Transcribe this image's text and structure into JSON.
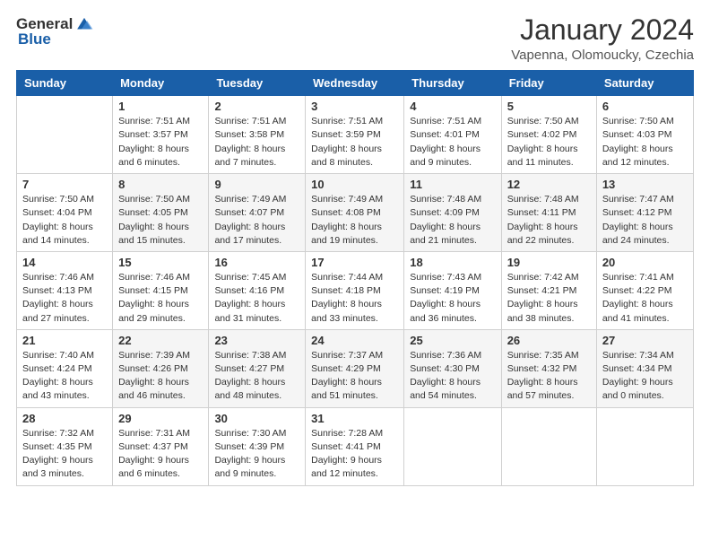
{
  "logo": {
    "text_general": "General",
    "text_blue": "Blue"
  },
  "title": "January 2024",
  "subtitle": "Vapenna, Olomoucky, Czechia",
  "weekdays": [
    "Sunday",
    "Monday",
    "Tuesday",
    "Wednesday",
    "Thursday",
    "Friday",
    "Saturday"
  ],
  "weeks": [
    [
      {
        "day": "",
        "sunrise": "",
        "sunset": "",
        "daylight": ""
      },
      {
        "day": "1",
        "sunrise": "Sunrise: 7:51 AM",
        "sunset": "Sunset: 3:57 PM",
        "daylight": "Daylight: 8 hours and 6 minutes."
      },
      {
        "day": "2",
        "sunrise": "Sunrise: 7:51 AM",
        "sunset": "Sunset: 3:58 PM",
        "daylight": "Daylight: 8 hours and 7 minutes."
      },
      {
        "day": "3",
        "sunrise": "Sunrise: 7:51 AM",
        "sunset": "Sunset: 3:59 PM",
        "daylight": "Daylight: 8 hours and 8 minutes."
      },
      {
        "day": "4",
        "sunrise": "Sunrise: 7:51 AM",
        "sunset": "Sunset: 4:01 PM",
        "daylight": "Daylight: 8 hours and 9 minutes."
      },
      {
        "day": "5",
        "sunrise": "Sunrise: 7:50 AM",
        "sunset": "Sunset: 4:02 PM",
        "daylight": "Daylight: 8 hours and 11 minutes."
      },
      {
        "day": "6",
        "sunrise": "Sunrise: 7:50 AM",
        "sunset": "Sunset: 4:03 PM",
        "daylight": "Daylight: 8 hours and 12 minutes."
      }
    ],
    [
      {
        "day": "7",
        "sunrise": "Sunrise: 7:50 AM",
        "sunset": "Sunset: 4:04 PM",
        "daylight": "Daylight: 8 hours and 14 minutes."
      },
      {
        "day": "8",
        "sunrise": "Sunrise: 7:50 AM",
        "sunset": "Sunset: 4:05 PM",
        "daylight": "Daylight: 8 hours and 15 minutes."
      },
      {
        "day": "9",
        "sunrise": "Sunrise: 7:49 AM",
        "sunset": "Sunset: 4:07 PM",
        "daylight": "Daylight: 8 hours and 17 minutes."
      },
      {
        "day": "10",
        "sunrise": "Sunrise: 7:49 AM",
        "sunset": "Sunset: 4:08 PM",
        "daylight": "Daylight: 8 hours and 19 minutes."
      },
      {
        "day": "11",
        "sunrise": "Sunrise: 7:48 AM",
        "sunset": "Sunset: 4:09 PM",
        "daylight": "Daylight: 8 hours and 21 minutes."
      },
      {
        "day": "12",
        "sunrise": "Sunrise: 7:48 AM",
        "sunset": "Sunset: 4:11 PM",
        "daylight": "Daylight: 8 hours and 22 minutes."
      },
      {
        "day": "13",
        "sunrise": "Sunrise: 7:47 AM",
        "sunset": "Sunset: 4:12 PM",
        "daylight": "Daylight: 8 hours and 24 minutes."
      }
    ],
    [
      {
        "day": "14",
        "sunrise": "Sunrise: 7:46 AM",
        "sunset": "Sunset: 4:13 PM",
        "daylight": "Daylight: 8 hours and 27 minutes."
      },
      {
        "day": "15",
        "sunrise": "Sunrise: 7:46 AM",
        "sunset": "Sunset: 4:15 PM",
        "daylight": "Daylight: 8 hours and 29 minutes."
      },
      {
        "day": "16",
        "sunrise": "Sunrise: 7:45 AM",
        "sunset": "Sunset: 4:16 PM",
        "daylight": "Daylight: 8 hours and 31 minutes."
      },
      {
        "day": "17",
        "sunrise": "Sunrise: 7:44 AM",
        "sunset": "Sunset: 4:18 PM",
        "daylight": "Daylight: 8 hours and 33 minutes."
      },
      {
        "day": "18",
        "sunrise": "Sunrise: 7:43 AM",
        "sunset": "Sunset: 4:19 PM",
        "daylight": "Daylight: 8 hours and 36 minutes."
      },
      {
        "day": "19",
        "sunrise": "Sunrise: 7:42 AM",
        "sunset": "Sunset: 4:21 PM",
        "daylight": "Daylight: 8 hours and 38 minutes."
      },
      {
        "day": "20",
        "sunrise": "Sunrise: 7:41 AM",
        "sunset": "Sunset: 4:22 PM",
        "daylight": "Daylight: 8 hours and 41 minutes."
      }
    ],
    [
      {
        "day": "21",
        "sunrise": "Sunrise: 7:40 AM",
        "sunset": "Sunset: 4:24 PM",
        "daylight": "Daylight: 8 hours and 43 minutes."
      },
      {
        "day": "22",
        "sunrise": "Sunrise: 7:39 AM",
        "sunset": "Sunset: 4:26 PM",
        "daylight": "Daylight: 8 hours and 46 minutes."
      },
      {
        "day": "23",
        "sunrise": "Sunrise: 7:38 AM",
        "sunset": "Sunset: 4:27 PM",
        "daylight": "Daylight: 8 hours and 48 minutes."
      },
      {
        "day": "24",
        "sunrise": "Sunrise: 7:37 AM",
        "sunset": "Sunset: 4:29 PM",
        "daylight": "Daylight: 8 hours and 51 minutes."
      },
      {
        "day": "25",
        "sunrise": "Sunrise: 7:36 AM",
        "sunset": "Sunset: 4:30 PM",
        "daylight": "Daylight: 8 hours and 54 minutes."
      },
      {
        "day": "26",
        "sunrise": "Sunrise: 7:35 AM",
        "sunset": "Sunset: 4:32 PM",
        "daylight": "Daylight: 8 hours and 57 minutes."
      },
      {
        "day": "27",
        "sunrise": "Sunrise: 7:34 AM",
        "sunset": "Sunset: 4:34 PM",
        "daylight": "Daylight: 9 hours and 0 minutes."
      }
    ],
    [
      {
        "day": "28",
        "sunrise": "Sunrise: 7:32 AM",
        "sunset": "Sunset: 4:35 PM",
        "daylight": "Daylight: 9 hours and 3 minutes."
      },
      {
        "day": "29",
        "sunrise": "Sunrise: 7:31 AM",
        "sunset": "Sunset: 4:37 PM",
        "daylight": "Daylight: 9 hours and 6 minutes."
      },
      {
        "day": "30",
        "sunrise": "Sunrise: 7:30 AM",
        "sunset": "Sunset: 4:39 PM",
        "daylight": "Daylight: 9 hours and 9 minutes."
      },
      {
        "day": "31",
        "sunrise": "Sunrise: 7:28 AM",
        "sunset": "Sunset: 4:41 PM",
        "daylight": "Daylight: 9 hours and 12 minutes."
      },
      {
        "day": "",
        "sunrise": "",
        "sunset": "",
        "daylight": ""
      },
      {
        "day": "",
        "sunrise": "",
        "sunset": "",
        "daylight": ""
      },
      {
        "day": "",
        "sunrise": "",
        "sunset": "",
        "daylight": ""
      }
    ]
  ]
}
